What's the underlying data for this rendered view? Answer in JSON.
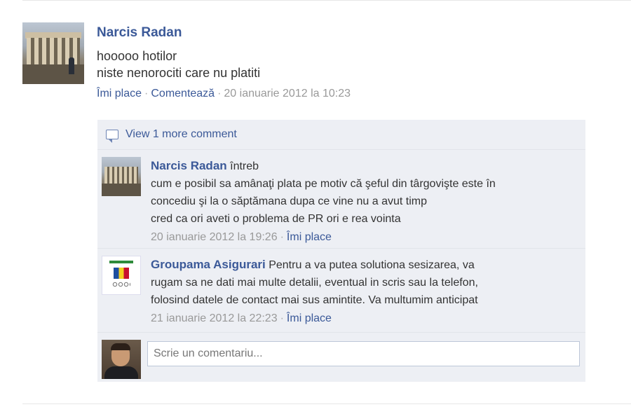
{
  "post": {
    "author": "Narcis Radan",
    "lines": [
      "hooooo hotilor",
      "niste nenorociti care nu platiti"
    ],
    "like_link": "Îmi place",
    "comment_link": "Comentează",
    "timestamp": "20 ianuarie 2012 la 10:23"
  },
  "comments_box": {
    "view_more": "View 1 more comment",
    "comments": [
      {
        "author": "Narcis Radan",
        "text_first": "întreb",
        "lines": [
          "cum e posibil sa amânaţi plata pe motiv că şeful din târgovişte este în",
          "concediu şi la o săptămana dupa ce vine nu a avut timp",
          "cred ca ori aveti o problema de PR ori e rea vointa"
        ],
        "timestamp": "20 ianuarie 2012 la 19:26",
        "like_link": "Îmi place"
      },
      {
        "author": "Groupama Asigurari",
        "text_first": "Pentru a va putea solutiona sesizarea, va",
        "lines": [
          "rugam sa ne dati mai multe detalii, eventual in scris sau la telefon,",
          "folosind datele de contact mai sus amintite. Va multumim anticipat"
        ],
        "timestamp": "21 ianuarie 2012 la 22:23",
        "like_link": "Îmi place"
      }
    ],
    "reply_placeholder": "Scrie un comentariu..."
  },
  "colors": {
    "link": "#3b5998",
    "meta": "#999999",
    "ufi_background": "#edeff4"
  },
  "icons": [
    "comment-bubble-icon"
  ]
}
